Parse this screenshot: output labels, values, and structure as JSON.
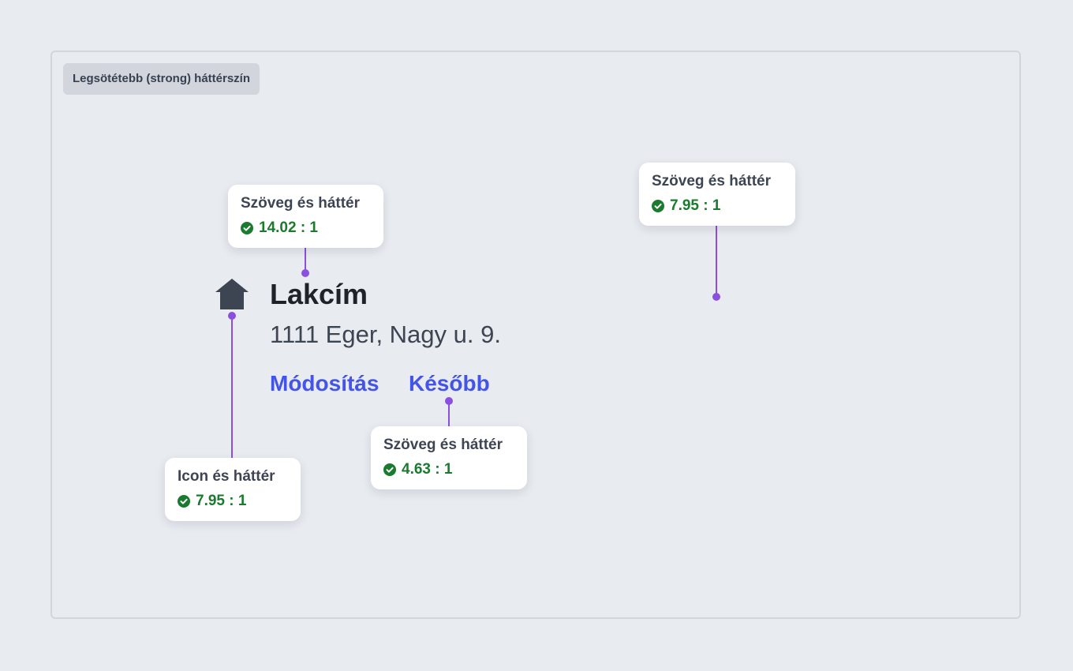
{
  "frame": {
    "label": "Legsötétebb (strong) háttérszín"
  },
  "content": {
    "icon": "home-icon",
    "title": "Lakcím",
    "address": "1111 Eger, Nagy u. 9.",
    "actions": [
      "Módosítás",
      "Később"
    ]
  },
  "annotations": [
    {
      "title": "Szöveg és háttér",
      "ratio": "14.02 : 1",
      "status_icon": "check-circle-icon"
    },
    {
      "title": "Szöveg és háttér",
      "ratio": "7.95 : 1",
      "status_icon": "check-circle-icon"
    },
    {
      "title": "Szöveg és háttér",
      "ratio": "4.63 : 1",
      "status_icon": "check-circle-icon"
    },
    {
      "title": "Icon és háttér",
      "ratio": "7.95 : 1",
      "status_icon": "check-circle-icon"
    }
  ],
  "colors": {
    "background": "#e8ebf0",
    "link": "#4454e6",
    "pass": "#1a7a2e",
    "connector": "#8b4fe0"
  }
}
